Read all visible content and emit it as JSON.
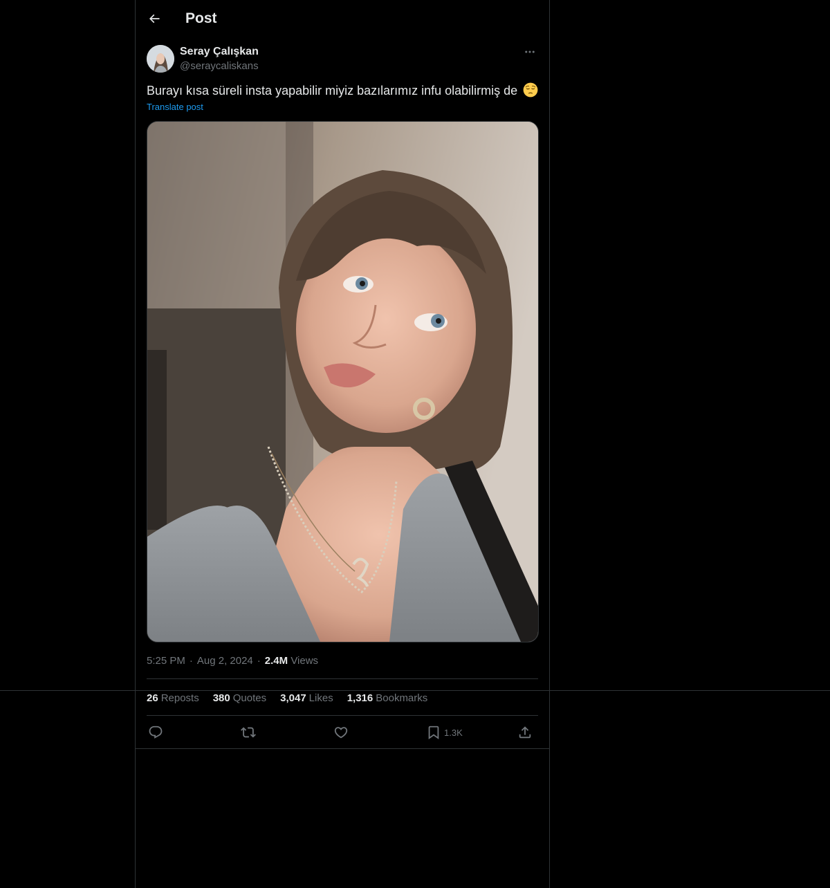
{
  "header": {
    "title": "Post"
  },
  "author": {
    "display_name": "Seray Çalışkan",
    "handle": "@seraycaliskans"
  },
  "post": {
    "text": "Burayı kısa süreli insta yapabilir miyiz bazılarımız infu olabilirmiş de",
    "emoji": "pensive-face",
    "translate_label": "Translate post",
    "time": "5:25 PM",
    "date": "Aug 2, 2024",
    "views_count": "2.4M",
    "views_label": "Views"
  },
  "stats": {
    "reposts": {
      "count": "26",
      "label": "Reposts"
    },
    "quotes": {
      "count": "380",
      "label": "Quotes"
    },
    "likes": {
      "count": "3,047",
      "label": "Likes"
    },
    "bookmarks": {
      "count": "1,316",
      "label": "Bookmarks"
    }
  },
  "actions": {
    "reply_icon": "reply-icon",
    "repost_icon": "repost-icon",
    "like_icon": "heart-icon",
    "bookmark_icon": "bookmark-icon",
    "bookmark_count": "1.3K",
    "share_icon": "share-icon"
  },
  "colors": {
    "background": "#000000",
    "text": "#e7e9ea",
    "secondary": "#71767b",
    "accent": "#1d9bf0",
    "border": "#2f3336"
  }
}
